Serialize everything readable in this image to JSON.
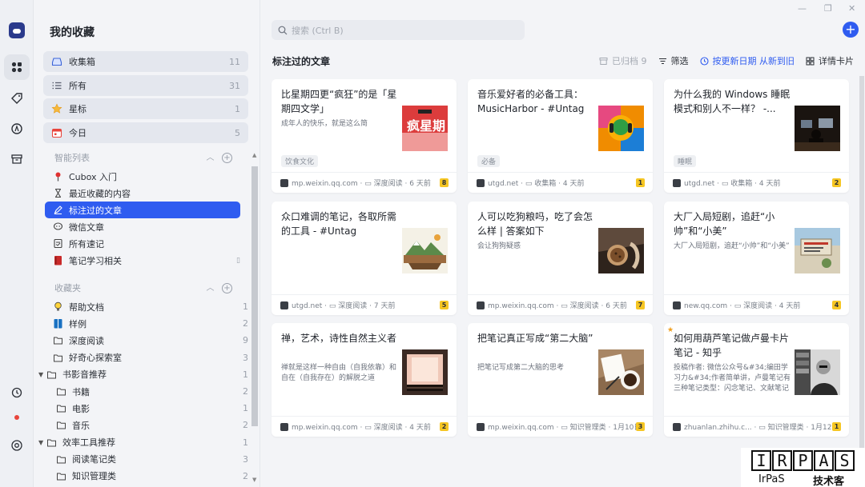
{
  "sidebar": {
    "title": "我的收藏",
    "fixed": [
      {
        "label": "收集箱",
        "count": "11",
        "icon": "inbox-icon"
      },
      {
        "label": "所有",
        "count": "31",
        "icon": "list-icon"
      },
      {
        "label": "星标",
        "count": "1",
        "icon": "star-icon"
      },
      {
        "label": "今日",
        "count": "5",
        "icon": "calendar-icon"
      }
    ],
    "smart_section": "智能列表",
    "smart": [
      {
        "label": "Cubox 入门",
        "count": "",
        "icon": "pin-icon"
      },
      {
        "label": "最近收藏的内容",
        "count": "",
        "icon": "hourglass-icon"
      },
      {
        "label": "标注过的文章",
        "count": "",
        "icon": "highlighter-icon"
      },
      {
        "label": "微信文章",
        "count": "",
        "icon": "chat-icon"
      },
      {
        "label": "所有速记",
        "count": "",
        "icon": "memo-icon"
      },
      {
        "label": "笔记学习相关",
        "count": "",
        "icon": "book-icon"
      }
    ],
    "folder_section": "收藏夹",
    "folders": [
      {
        "label": "帮助文档",
        "count": "1"
      },
      {
        "label": "样例",
        "count": "2"
      },
      {
        "label": "深度阅读",
        "count": "9"
      },
      {
        "label": "好奇心探索室",
        "count": "3"
      },
      {
        "label": "书影音推荐",
        "count": "1"
      },
      {
        "label": "书籍",
        "count": "2"
      },
      {
        "label": "电影",
        "count": "1"
      },
      {
        "label": "音乐",
        "count": "2"
      },
      {
        "label": "效率工具推荐",
        "count": "1"
      },
      {
        "label": "阅读笔记类",
        "count": "3"
      },
      {
        "label": "知识管理类",
        "count": "2"
      }
    ]
  },
  "main": {
    "search_placeholder": "搜索 (Ctrl B)",
    "section_title": "标注过的文章",
    "toolbar": {
      "archived": "已归档 9",
      "filter": "筛选",
      "sort": "按更新日期 从新到旧",
      "view": "详情卡片"
    }
  },
  "cards": [
    {
      "title": "比星期四更“疯狂”的是「星期四文学」",
      "excerpt": "成年人的快乐，就是这么简",
      "tag": "饮食文化",
      "source": "mp.weixin.qq.com",
      "folder": "深度阅读",
      "time": "6 天前",
      "highlights": "8",
      "starred": false,
      "thumb": "thumb-red"
    },
    {
      "title": "音乐爱好者的必备工具：MusicHarbor - #Untag",
      "excerpt": "",
      "tag": "必备",
      "source": "utgd.net",
      "folder": "收集箱",
      "time": "4 天前",
      "highlights": "1",
      "starred": false,
      "thumb": "thumb-colorful"
    },
    {
      "title": "为什么我的 Windows 睡眠模式和别人不一样？ -...",
      "excerpt": "",
      "tag": "睡眠",
      "source": "utgd.net",
      "folder": "收集箱",
      "time": "4 天前",
      "highlights": "2",
      "starred": false,
      "thumb": "thumb-dark"
    },
    {
      "title": "众口难调的笔记，各取所需的工具 - #Untag",
      "excerpt": "",
      "tag": "",
      "source": "utgd.net",
      "folder": "深度阅读",
      "time": "7 天前",
      "highlights": "5",
      "starred": false,
      "thumb": "thumb-landscape"
    },
    {
      "title": "人可以吃狗粮吗，吃了会怎么样 | 答案如下",
      "excerpt": "会让狗狗疑惑",
      "tag": "",
      "source": "mp.weixin.qq.com",
      "folder": "深度阅读",
      "time": "6 天前",
      "highlights": "7",
      "starred": false,
      "thumb": "thumb-food"
    },
    {
      "title": "大厂入局短剧，追赶“小帅”和“小美”",
      "excerpt": "大厂入局短剧，追赶“小帅”和“小美”",
      "tag": "",
      "source": "new.qq.com",
      "folder": "深度阅读",
      "time": "4 天前",
      "highlights": "4",
      "starred": false,
      "thumb": "thumb-poster"
    },
    {
      "title": "禅，艺术，诗性自然主义者",
      "excerpt": "禅就是这样一种自由（自我依靠）和自在（自我存在）的解脱之道",
      "tag": "",
      "source": "mp.weixin.qq.com",
      "folder": "深度阅读",
      "time": "4 天前",
      "highlights": "2",
      "starred": false,
      "thumb": "thumb-stage"
    },
    {
      "title": "把笔记真正写成“第二大脑”",
      "excerpt": "把笔记写成第二大脑的思考",
      "tag": "",
      "source": "mp.weixin.qq.com",
      "folder": "知识管理类",
      "time": "1月10日",
      "highlights": "3",
      "starred": false,
      "thumb": "thumb-coffee"
    },
    {
      "title": "如何用葫芦笔记做卢曼卡片笔记 - 知乎",
      "excerpt": "投稿作者: 微信公众号&#34;编田学习力&#34;作者简单讲，卢曼笔记有三种笔记类型：闪念笔记、文献笔记和永...",
      "tag": "",
      "source": "zhuanlan.zhihu.c...",
      "folder": "知识管理类",
      "time": "1月12日",
      "highlights": "1",
      "starred": true,
      "thumb": "thumb-portrait"
    }
  ],
  "watermark": {
    "letters": [
      "I",
      "R",
      "P",
      "A",
      "S"
    ],
    "caption_left": "IrPaS",
    "caption_right": "技术客"
  }
}
